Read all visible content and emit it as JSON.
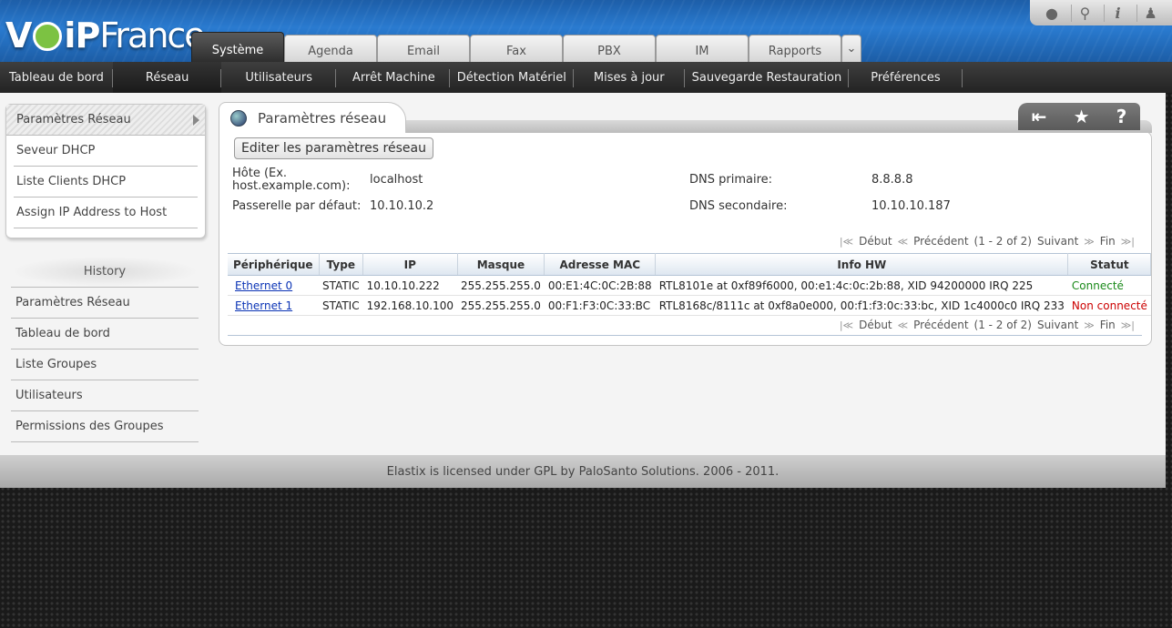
{
  "brand": {
    "logo_prefix": "V",
    "logo_middle": "iP",
    "logo_suffix": "France"
  },
  "toptools": [
    "drop-icon",
    "search-icon",
    "info-icon",
    "user-icon"
  ],
  "tabs": [
    {
      "label": "Système",
      "active": true
    },
    {
      "label": "Agenda"
    },
    {
      "label": "Email"
    },
    {
      "label": "Fax"
    },
    {
      "label": "PBX"
    },
    {
      "label": "IM"
    },
    {
      "label": "Rapports"
    }
  ],
  "subnav": [
    {
      "label": "Tableau de bord"
    },
    {
      "label": "Réseau",
      "active": true
    },
    {
      "label": "Utilisateurs"
    },
    {
      "label": "Arrêt Machine"
    },
    {
      "label": "Détection Matériel"
    },
    {
      "label": "Mises à jour"
    },
    {
      "label": "Sauvegarde Restauration"
    },
    {
      "label": "Préférences"
    }
  ],
  "leftmenu": [
    {
      "label": "Paramètres Réseau",
      "active": true
    },
    {
      "label": "Seveur DHCP"
    },
    {
      "label": "Liste Clients DHCP"
    },
    {
      "label": "Assign IP Address to Host"
    }
  ],
  "history": {
    "title": "History",
    "items": [
      "Paramètres Réseau",
      "Tableau de bord",
      "Liste Groupes",
      "Utilisateurs",
      "Permissions des Groupes"
    ]
  },
  "panel": {
    "title": "Paramètres réseau",
    "edit_button": "Editer les paramètres réseau",
    "host_label_1": "Hôte (Ex.",
    "host_label_2": "host.example.com):",
    "host_value": "localhost",
    "gateway_label": "Passerelle par défaut:",
    "gateway_value": "10.10.10.2",
    "dns1_label": "DNS primaire:",
    "dns1_value": "8.8.8.8",
    "dns2_label": "DNS secondaire:",
    "dns2_value": "10.10.10.187"
  },
  "pager": {
    "first": "Début",
    "prev": "Précédent",
    "range": "(1 - 2 of 2)",
    "next": "Suivant",
    "last": "Fin"
  },
  "table": {
    "headers": [
      "Périphérique",
      "Type",
      "IP",
      "Masque",
      "Adresse MAC",
      "Info HW",
      "Statut"
    ],
    "rows": [
      [
        "Ethernet 0",
        "STATIC",
        "10.10.10.222",
        "255.255.255.0",
        "00:E1:4C:0C:2B:88",
        "RTL8101e at 0xf89f6000, 00:e1:4c:0c:2b:88, XID 94200000 IRQ 225",
        "Connecté"
      ],
      [
        "Ethernet 1",
        "STATIC",
        "192.168.10.100",
        "255.255.255.0",
        "00:F1:F3:0C:33:BC",
        "RTL8168c/8111c at 0xf8a0e000, 00:f1:f3:0c:33:bc, XID 1c4000c0 IRQ 233",
        "Non connecté"
      ]
    ]
  },
  "footer": "Elastix is licensed under GPL by PaloSanto Solutions. 2006 - 2011.",
  "colors": {
    "connected": "#1a8a1a",
    "disconnected": "#cc0000",
    "header_blue": "#2a7bd0"
  }
}
